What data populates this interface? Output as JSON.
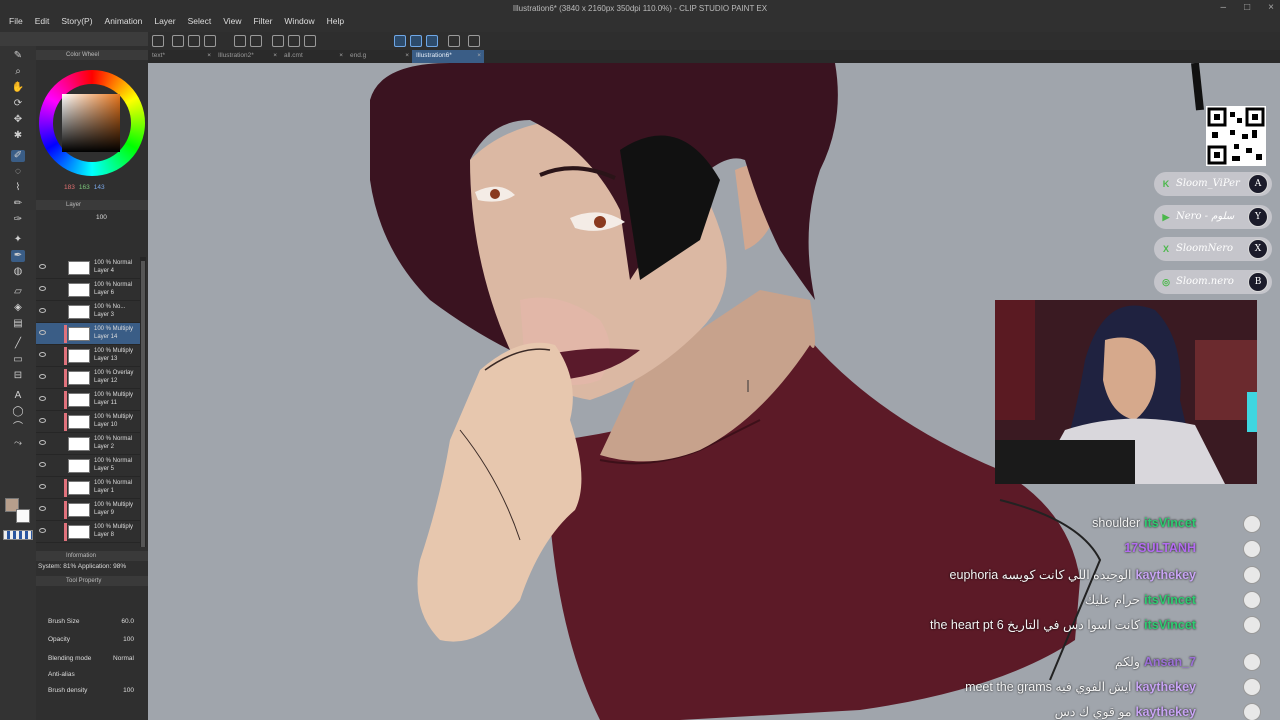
{
  "window": {
    "title": "Illustration6* (3840 x 2160px 350dpi 110.0%) - CLIP STUDIO PAINT EX",
    "menu": [
      "File",
      "Edit",
      "Story(P)",
      "Animation",
      "Layer",
      "Select",
      "View",
      "Filter",
      "Window",
      "Help"
    ]
  },
  "tabs": [
    {
      "label": "text*",
      "active": false
    },
    {
      "label": "Illustration2*",
      "active": false
    },
    {
      "label": "all.cmt",
      "active": false
    },
    {
      "label": "end.g",
      "active": false
    },
    {
      "label": "Illustration6*",
      "active": true
    }
  ],
  "color_wheel": {
    "title": "Color Wheel",
    "r": "183",
    "g": "163",
    "b": "143",
    "current_color": "#b79f8c"
  },
  "layer_panel": {
    "title": "Layer",
    "opacity": "100",
    "layers": [
      {
        "mode": "100 % Normal",
        "name": "Layer 4",
        "clipped": false,
        "selected": false
      },
      {
        "mode": "100 % Normal",
        "name": "Layer 6",
        "clipped": false,
        "selected": false
      },
      {
        "mode": "100 % No...",
        "name": "Layer 3",
        "clipped": false,
        "selected": false
      },
      {
        "mode": "100 % Multiply",
        "name": "Layer 14",
        "clipped": true,
        "selected": true
      },
      {
        "mode": "100 % Multiply",
        "name": "Layer 13",
        "clipped": true,
        "selected": false
      },
      {
        "mode": "100 % Overlay",
        "name": "Layer 12",
        "clipped": true,
        "selected": false
      },
      {
        "mode": "100 % Multiply",
        "name": "Layer 11",
        "clipped": true,
        "selected": false
      },
      {
        "mode": "100 % Multiply",
        "name": "Layer 10",
        "clipped": true,
        "selected": false
      },
      {
        "mode": "100 % Normal",
        "name": "Layer 2",
        "clipped": false,
        "selected": false
      },
      {
        "mode": "100 % Normal",
        "name": "Layer 5",
        "clipped": false,
        "selected": false
      },
      {
        "mode": "100 % Normal",
        "name": "Layer 1",
        "clipped": true,
        "selected": false
      },
      {
        "mode": "100 % Multiply",
        "name": "Layer 9",
        "clipped": true,
        "selected": false
      },
      {
        "mode": "100 % Multiply",
        "name": "Layer 8",
        "clipped": true,
        "selected": false
      }
    ]
  },
  "information": {
    "title": "Information",
    "system_text": "System: 81% Application: 98%"
  },
  "tool_property": {
    "title": "Tool Property",
    "brush_size_label": "Brush Size",
    "brush_size_value": "60.0",
    "opacity_label": "Opacity",
    "opacity_value": "100",
    "blending_label": "Blending mode",
    "blending_value": "Normal",
    "antialias_label": "Anti-alias",
    "density_label": "Brush density",
    "density_value": "100"
  },
  "overlay": {
    "socials": [
      {
        "icon": "K",
        "handle": "Sloom_ViPer",
        "avatar": "A",
        "icon_name": "kick-icon"
      },
      {
        "icon": "▶",
        "handle": "Nero - سلوم",
        "avatar": "Y",
        "icon_name": "youtube-icon"
      },
      {
        "icon": "X",
        "handle": "SloomNero",
        "avatar": "X",
        "icon_name": "x-icon"
      },
      {
        "icon": "◎",
        "handle": "Sloom.nero",
        "avatar": "B",
        "icon_name": "instagram-icon"
      }
    ],
    "chat": [
      {
        "message": "shoulder",
        "user": "itsVincet",
        "color": "#2ecc71"
      },
      {
        "message": "",
        "user": "17SULTANH",
        "color": "#b36cf0"
      },
      {
        "message": "euphoria الوحيده اللي كانت كويسه",
        "user": "kaythekey",
        "color": "#c8a4f4"
      },
      {
        "message": "حرام عليك",
        "user": "itsVincet",
        "color": "#2ecc71"
      },
      {
        "message": "the heart pt 6 كانت اسوا دس في التاريخ",
        "user": "itsVincet",
        "color": "#2ecc71"
      },
      {
        "message": "ولكم",
        "user": "Ansan_7",
        "color": "#9b6fd6"
      },
      {
        "message": "meet the grams ايش الفوي فيه",
        "user": "kaythekey",
        "color": "#c8a4f4"
      },
      {
        "message": "مو قوي ك دس",
        "user": "kaythekey",
        "color": "#c8a4f4"
      }
    ]
  }
}
